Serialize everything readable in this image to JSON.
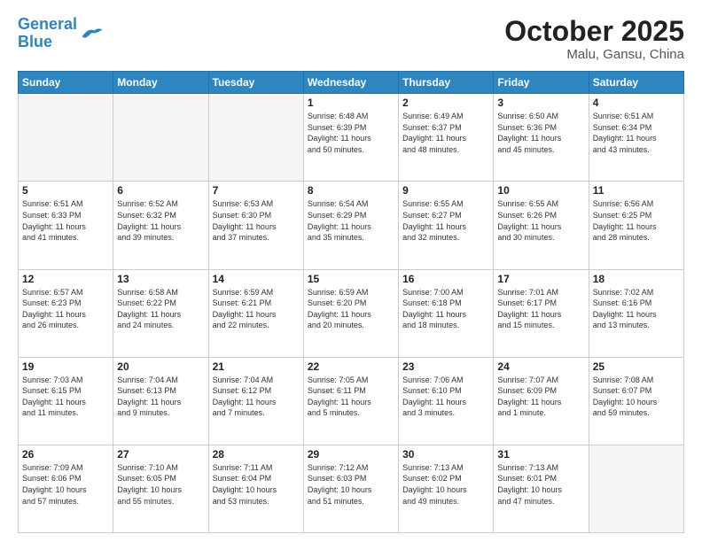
{
  "header": {
    "logo_line1": "General",
    "logo_line2": "Blue",
    "month": "October 2025",
    "location": "Malu, Gansu, China"
  },
  "days_of_week": [
    "Sunday",
    "Monday",
    "Tuesday",
    "Wednesday",
    "Thursday",
    "Friday",
    "Saturday"
  ],
  "weeks": [
    [
      {
        "num": "",
        "info": ""
      },
      {
        "num": "",
        "info": ""
      },
      {
        "num": "",
        "info": ""
      },
      {
        "num": "1",
        "info": "Sunrise: 6:48 AM\nSunset: 6:39 PM\nDaylight: 11 hours\nand 50 minutes."
      },
      {
        "num": "2",
        "info": "Sunrise: 6:49 AM\nSunset: 6:37 PM\nDaylight: 11 hours\nand 48 minutes."
      },
      {
        "num": "3",
        "info": "Sunrise: 6:50 AM\nSunset: 6:36 PM\nDaylight: 11 hours\nand 45 minutes."
      },
      {
        "num": "4",
        "info": "Sunrise: 6:51 AM\nSunset: 6:34 PM\nDaylight: 11 hours\nand 43 minutes."
      }
    ],
    [
      {
        "num": "5",
        "info": "Sunrise: 6:51 AM\nSunset: 6:33 PM\nDaylight: 11 hours\nand 41 minutes."
      },
      {
        "num": "6",
        "info": "Sunrise: 6:52 AM\nSunset: 6:32 PM\nDaylight: 11 hours\nand 39 minutes."
      },
      {
        "num": "7",
        "info": "Sunrise: 6:53 AM\nSunset: 6:30 PM\nDaylight: 11 hours\nand 37 minutes."
      },
      {
        "num": "8",
        "info": "Sunrise: 6:54 AM\nSunset: 6:29 PM\nDaylight: 11 hours\nand 35 minutes."
      },
      {
        "num": "9",
        "info": "Sunrise: 6:55 AM\nSunset: 6:27 PM\nDaylight: 11 hours\nand 32 minutes."
      },
      {
        "num": "10",
        "info": "Sunrise: 6:55 AM\nSunset: 6:26 PM\nDaylight: 11 hours\nand 30 minutes."
      },
      {
        "num": "11",
        "info": "Sunrise: 6:56 AM\nSunset: 6:25 PM\nDaylight: 11 hours\nand 28 minutes."
      }
    ],
    [
      {
        "num": "12",
        "info": "Sunrise: 6:57 AM\nSunset: 6:23 PM\nDaylight: 11 hours\nand 26 minutes."
      },
      {
        "num": "13",
        "info": "Sunrise: 6:58 AM\nSunset: 6:22 PM\nDaylight: 11 hours\nand 24 minutes."
      },
      {
        "num": "14",
        "info": "Sunrise: 6:59 AM\nSunset: 6:21 PM\nDaylight: 11 hours\nand 22 minutes."
      },
      {
        "num": "15",
        "info": "Sunrise: 6:59 AM\nSunset: 6:20 PM\nDaylight: 11 hours\nand 20 minutes."
      },
      {
        "num": "16",
        "info": "Sunrise: 7:00 AM\nSunset: 6:18 PM\nDaylight: 11 hours\nand 18 minutes."
      },
      {
        "num": "17",
        "info": "Sunrise: 7:01 AM\nSunset: 6:17 PM\nDaylight: 11 hours\nand 15 minutes."
      },
      {
        "num": "18",
        "info": "Sunrise: 7:02 AM\nSunset: 6:16 PM\nDaylight: 11 hours\nand 13 minutes."
      }
    ],
    [
      {
        "num": "19",
        "info": "Sunrise: 7:03 AM\nSunset: 6:15 PM\nDaylight: 11 hours\nand 11 minutes."
      },
      {
        "num": "20",
        "info": "Sunrise: 7:04 AM\nSunset: 6:13 PM\nDaylight: 11 hours\nand 9 minutes."
      },
      {
        "num": "21",
        "info": "Sunrise: 7:04 AM\nSunset: 6:12 PM\nDaylight: 11 hours\nand 7 minutes."
      },
      {
        "num": "22",
        "info": "Sunrise: 7:05 AM\nSunset: 6:11 PM\nDaylight: 11 hours\nand 5 minutes."
      },
      {
        "num": "23",
        "info": "Sunrise: 7:06 AM\nSunset: 6:10 PM\nDaylight: 11 hours\nand 3 minutes."
      },
      {
        "num": "24",
        "info": "Sunrise: 7:07 AM\nSunset: 6:09 PM\nDaylight: 11 hours\nand 1 minute."
      },
      {
        "num": "25",
        "info": "Sunrise: 7:08 AM\nSunset: 6:07 PM\nDaylight: 10 hours\nand 59 minutes."
      }
    ],
    [
      {
        "num": "26",
        "info": "Sunrise: 7:09 AM\nSunset: 6:06 PM\nDaylight: 10 hours\nand 57 minutes."
      },
      {
        "num": "27",
        "info": "Sunrise: 7:10 AM\nSunset: 6:05 PM\nDaylight: 10 hours\nand 55 minutes."
      },
      {
        "num": "28",
        "info": "Sunrise: 7:11 AM\nSunset: 6:04 PM\nDaylight: 10 hours\nand 53 minutes."
      },
      {
        "num": "29",
        "info": "Sunrise: 7:12 AM\nSunset: 6:03 PM\nDaylight: 10 hours\nand 51 minutes."
      },
      {
        "num": "30",
        "info": "Sunrise: 7:13 AM\nSunset: 6:02 PM\nDaylight: 10 hours\nand 49 minutes."
      },
      {
        "num": "31",
        "info": "Sunrise: 7:13 AM\nSunset: 6:01 PM\nDaylight: 10 hours\nand 47 minutes."
      },
      {
        "num": "",
        "info": ""
      }
    ]
  ]
}
